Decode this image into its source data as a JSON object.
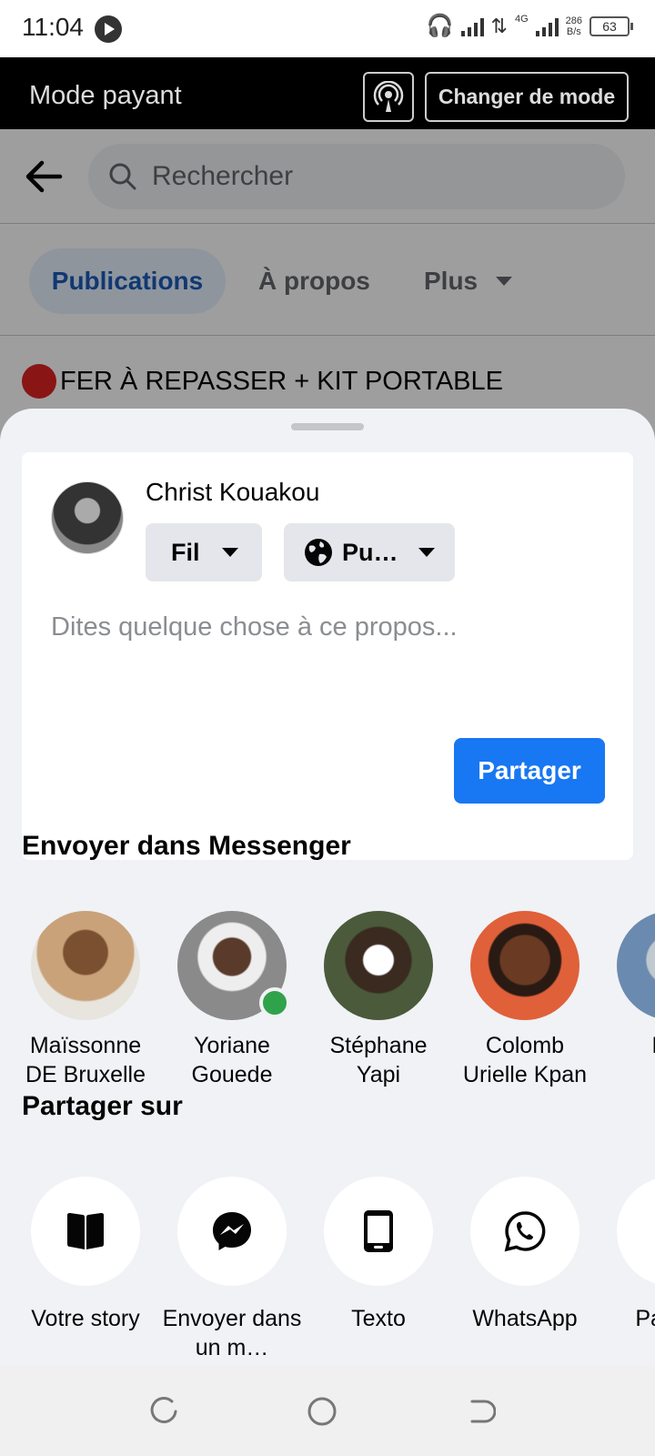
{
  "status_bar": {
    "time": "11:04",
    "network": "4G",
    "speed_top": "286",
    "speed_bottom": "B/s",
    "battery": "63"
  },
  "mode_bar": {
    "title": "Mode payant",
    "change_button": "Changer de mode"
  },
  "page": {
    "search_placeholder": "Rechercher",
    "tabs": [
      "Publications",
      "À propos",
      "Plus"
    ],
    "post_text": "FER À REPASSER + KIT PORTABLE"
  },
  "share_sheet": {
    "user_name": "Christ Kouakou",
    "destination": "Fil",
    "audience": "Pu…",
    "composer_placeholder": "Dites quelque chose à ce propos...",
    "share_button": "Partager",
    "messenger_title": "Envoyer dans Messenger",
    "contacts": [
      {
        "name": "Maïssonne DE Bruxelle",
        "color": "#c9a27a",
        "online": false
      },
      {
        "name": "Yoriane Gouede",
        "color": "#8a8a8a",
        "online": true
      },
      {
        "name": "Stéphane Yapi",
        "color": "#4a5a3a",
        "online": false
      },
      {
        "name": "Colomb Urielle Kpan",
        "color": "#e0603a",
        "online": false
      },
      {
        "name": "Bric",
        "color": "#6a8ab0",
        "online": false
      }
    ],
    "share_on_title": "Partager sur",
    "apps": [
      {
        "name": "Votre story",
        "icon": "book-icon"
      },
      {
        "name": "Envoyer dans un m…",
        "icon": "messenger-icon"
      },
      {
        "name": "Texto",
        "icon": "phone-icon"
      },
      {
        "name": "WhatsApp",
        "icon": "whatsapp-icon"
      },
      {
        "name": "Pa dan",
        "icon": "more-icon"
      }
    ]
  },
  "colors": {
    "accent": "#1877f2",
    "online": "#31a24c",
    "mode_bar_bg": "#000000"
  }
}
